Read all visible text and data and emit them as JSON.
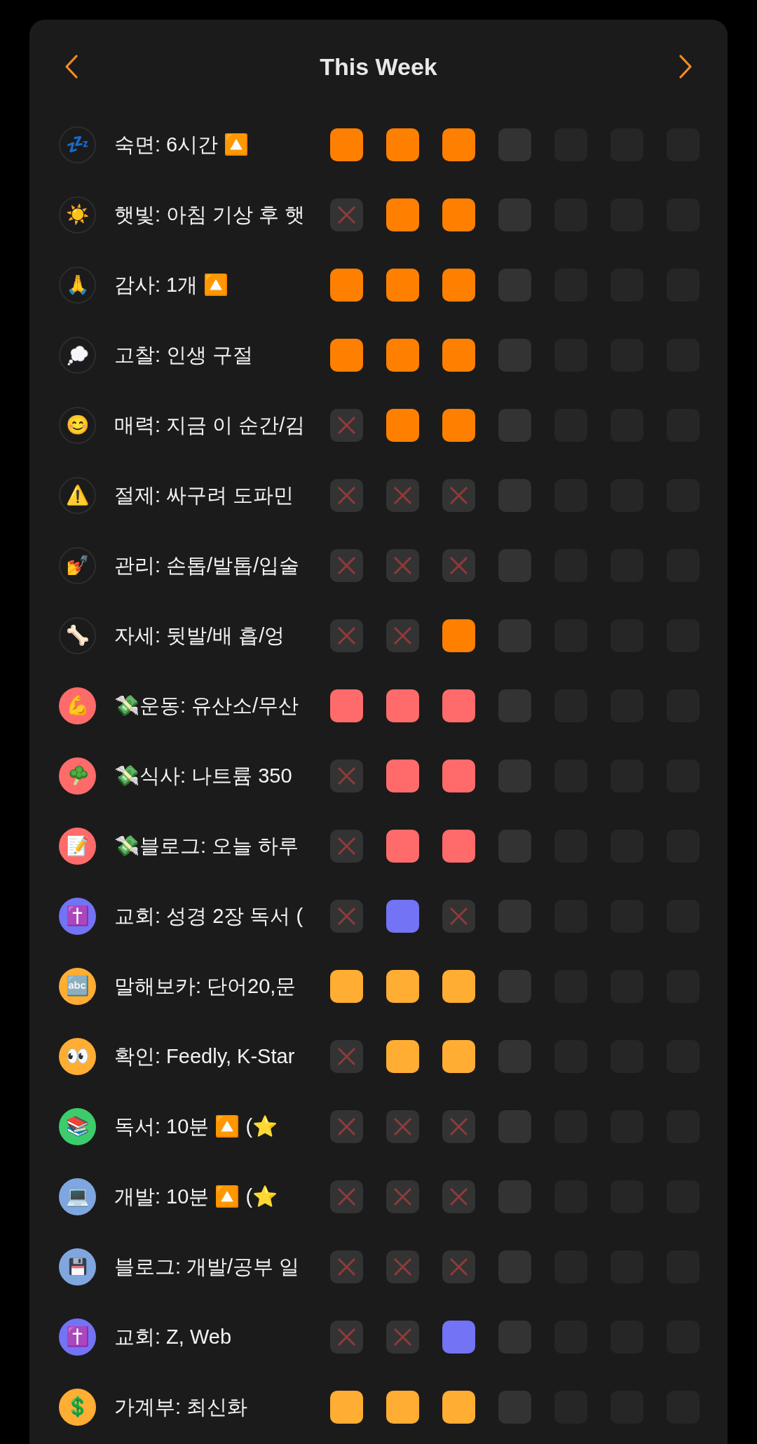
{
  "header": {
    "title": "This Week"
  },
  "habits": [
    {
      "icon": "💤",
      "label": "숙면: 6시간 🔼",
      "kind": "outline",
      "color": "#ff8000",
      "days": [
        {
          "kind": "done"
        },
        {
          "kind": "done"
        },
        {
          "kind": "done"
        },
        {
          "kind": "open"
        },
        {
          "kind": "future"
        },
        {
          "kind": "future"
        },
        {
          "kind": "future"
        }
      ]
    },
    {
      "icon": "☀️",
      "label": "햇빛: 아침 기상 후 햇",
      "kind": "outline",
      "color": "#ff8000",
      "days": [
        {
          "kind": "missed"
        },
        {
          "kind": "done"
        },
        {
          "kind": "done"
        },
        {
          "kind": "open"
        },
        {
          "kind": "future"
        },
        {
          "kind": "future"
        },
        {
          "kind": "future"
        }
      ]
    },
    {
      "icon": "🙏",
      "label": "감사: 1개 🔼",
      "kind": "outline",
      "color": "#ff8000",
      "days": [
        {
          "kind": "done"
        },
        {
          "kind": "done"
        },
        {
          "kind": "done"
        },
        {
          "kind": "open"
        },
        {
          "kind": "future"
        },
        {
          "kind": "future"
        },
        {
          "kind": "future"
        }
      ]
    },
    {
      "label": "고찰: 인생 구절",
      "kind": "outline",
      "color": "#ff8000",
      "days": [
        {
          "kind": "done"
        },
        {
          "kind": "done"
        },
        {
          "kind": "done"
        },
        {
          "kind": "open"
        },
        {
          "kind": "future"
        },
        {
          "kind": "future"
        },
        {
          "kind": "future"
        }
      ]
    },
    {
      "icon": "😊",
      "label": "매력: 지금 이 순간/김",
      "kind": "outline",
      "color": "#ff8000",
      "days": [
        {
          "kind": "missed"
        },
        {
          "kind": "done"
        },
        {
          "kind": "done"
        },
        {
          "kind": "open"
        },
        {
          "kind": "future"
        },
        {
          "kind": "future"
        },
        {
          "kind": "future"
        }
      ]
    },
    {
      "icon": "⚠️",
      "label": "절제: 싸구려 도파민",
      "kind": "outline",
      "days": [
        {
          "kind": "missed"
        },
        {
          "kind": "missed"
        },
        {
          "kind": "missed"
        },
        {
          "kind": "open"
        },
        {
          "kind": "future"
        },
        {
          "kind": "future"
        },
        {
          "kind": "future"
        }
      ]
    },
    {
      "icon": "💅",
      "label": "관리: 손톱/발톱/입술",
      "kind": "outline",
      "days": [
        {
          "kind": "missed"
        },
        {
          "kind": "missed"
        },
        {
          "kind": "missed"
        },
        {
          "kind": "open"
        },
        {
          "kind": "future"
        },
        {
          "kind": "future"
        },
        {
          "kind": "future"
        }
      ]
    },
    {
      "icon": "🦴",
      "label": "자세: 뒷발/배 흡/엉",
      "kind": "outline",
      "color": "#ff8000",
      "days": [
        {
          "kind": "missed"
        },
        {
          "kind": "missed"
        },
        {
          "kind": "done"
        },
        {
          "kind": "open"
        },
        {
          "kind": "future"
        },
        {
          "kind": "future"
        },
        {
          "kind": "future"
        }
      ]
    },
    {
      "icon": "💪",
      "label": "💸운동: 유산소/무산",
      "kind": "filled",
      "color": "#ff6b6b",
      "days": [
        {
          "kind": "done"
        },
        {
          "kind": "done"
        },
        {
          "kind": "done"
        },
        {
          "kind": "open"
        },
        {
          "kind": "future"
        },
        {
          "kind": "future"
        },
        {
          "kind": "future"
        }
      ]
    },
    {
      "label": "💸식사: 나트륨 350",
      "kind": "filled",
      "color": "#ff6b6b",
      "days": [
        {
          "kind": "missed"
        },
        {
          "kind": "done"
        },
        {
          "kind": "done"
        },
        {
          "kind": "open"
        },
        {
          "kind": "future"
        },
        {
          "kind": "future"
        },
        {
          "kind": "future"
        }
      ]
    },
    {
      "icon": "📝",
      "label": "💸블로그: 오늘 하루",
      "kind": "filled",
      "color": "#ff6b6b",
      "days": [
        {
          "kind": "missed"
        },
        {
          "kind": "done"
        },
        {
          "kind": "done"
        },
        {
          "kind": "open"
        },
        {
          "kind": "future"
        },
        {
          "kind": "future"
        },
        {
          "kind": "future"
        }
      ]
    },
    {
      "icon": "✝️",
      "label": "교회: 성경 2장 독서 (",
      "kind": "filled",
      "color": "#7373f5",
      "days": [
        {
          "kind": "missed"
        },
        {
          "kind": "done"
        },
        {
          "kind": "missed"
        },
        {
          "kind": "open"
        },
        {
          "kind": "future"
        },
        {
          "kind": "future"
        },
        {
          "kind": "future"
        }
      ]
    },
    {
      "icon": "🔤",
      "label": "말해보카: 단어20,문",
      "kind": "filled",
      "color": "#ffad33",
      "days": [
        {
          "kind": "done"
        },
        {
          "kind": "done"
        },
        {
          "kind": "done"
        },
        {
          "kind": "open"
        },
        {
          "kind": "future"
        },
        {
          "kind": "future"
        },
        {
          "kind": "future"
        }
      ]
    },
    {
      "icon": "👀",
      "label": "확인: Feedly, K-Star",
      "kind": "filled",
      "color": "#ffad33",
      "days": [
        {
          "kind": "missed"
        },
        {
          "kind": "done"
        },
        {
          "kind": "done"
        },
        {
          "kind": "open"
        },
        {
          "kind": "future"
        },
        {
          "kind": "future"
        },
        {
          "kind": "future"
        }
      ]
    },
    {
      "icon": "📚",
      "label": "독서: 10분 🔼 (⭐",
      "kind": "filled",
      "color": "#3dcc6b",
      "days": [
        {
          "kind": "missed"
        },
        {
          "kind": "missed"
        },
        {
          "kind": "missed"
        },
        {
          "kind": "open"
        },
        {
          "kind": "future"
        },
        {
          "kind": "future"
        },
        {
          "kind": "future"
        }
      ]
    },
    {
      "icon": "💻",
      "label": "개발: 10분 🔼 (⭐",
      "kind": "filled",
      "color": "#80a6e0",
      "days": [
        {
          "kind": "missed"
        },
        {
          "kind": "missed"
        },
        {
          "kind": "missed"
        },
        {
          "kind": "open"
        },
        {
          "kind": "future"
        },
        {
          "kind": "future"
        },
        {
          "kind": "future"
        }
      ]
    },
    {
      "label": "블로그: 개발/공부 일",
      "kind": "filled",
      "color": "#80a6e0",
      "days": [
        {
          "kind": "missed"
        },
        {
          "kind": "missed"
        },
        {
          "kind": "missed"
        },
        {
          "kind": "open"
        },
        {
          "kind": "future"
        },
        {
          "kind": "future"
        },
        {
          "kind": "future"
        }
      ]
    },
    {
      "icon": "✝️",
      "label": "교회: Z, Web",
      "kind": "filled",
      "color": "#7373f5",
      "days": [
        {
          "kind": "missed"
        },
        {
          "kind": "missed"
        },
        {
          "kind": "done"
        },
        {
          "kind": "open"
        },
        {
          "kind": "future"
        },
        {
          "kind": "future"
        },
        {
          "kind": "future"
        }
      ]
    },
    {
      "icon": "💲",
      "label": "가계부: 최신화",
      "kind": "filled",
      "color": "#ffad33",
      "days": [
        {
          "kind": "done"
        },
        {
          "kind": "done"
        },
        {
          "kind": "done"
        },
        {
          "kind": "open"
        },
        {
          "kind": "future"
        },
        {
          "kind": "future"
        },
        {
          "kind": "future"
        }
      ]
    }
  ]
}
